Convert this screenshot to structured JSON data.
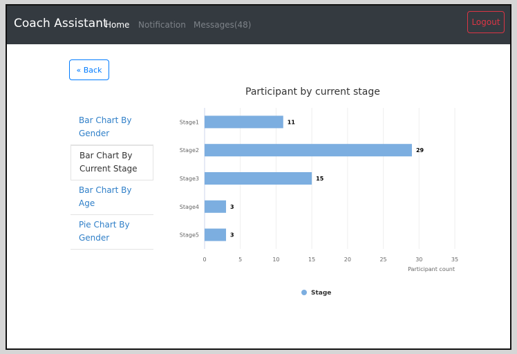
{
  "navbar": {
    "brand": "Coach Assistant",
    "links": [
      {
        "label": "Home"
      },
      {
        "label": "Notification"
      },
      {
        "label": "Messages(48)"
      }
    ],
    "logout_label": "Logout"
  },
  "back_button": {
    "label": "« Back"
  },
  "sidebar": {
    "items": [
      {
        "label": "Bar Chart By Gender",
        "active": false
      },
      {
        "label": "Bar Chart By Current Stage",
        "active": true
      },
      {
        "label": "Bar Chart By Age",
        "active": false
      },
      {
        "label": "Pie Chart By Gender",
        "active": false
      }
    ]
  },
  "chart_data": {
    "type": "bar",
    "orientation": "horizontal",
    "title": "Participant by current stage",
    "categories": [
      "Stage1",
      "Stage2",
      "Stage3",
      "Stage4",
      "Stage5"
    ],
    "series": [
      {
        "name": "Stage",
        "values": [
          11,
          29,
          15,
          3,
          3
        ],
        "color": "#7caee0"
      }
    ],
    "xlabel": "Participant count",
    "xlim": [
      0,
      35
    ],
    "xticks": [
      0,
      5,
      10,
      15,
      20,
      25,
      30,
      35
    ],
    "grid": true,
    "legend": "bottom-center",
    "data_labels": true
  },
  "colors": {
    "navbar_bg": "#343a40",
    "link_blue": "#2f7fc8",
    "logout_red": "#dc3545",
    "bar": "#7caee0"
  }
}
